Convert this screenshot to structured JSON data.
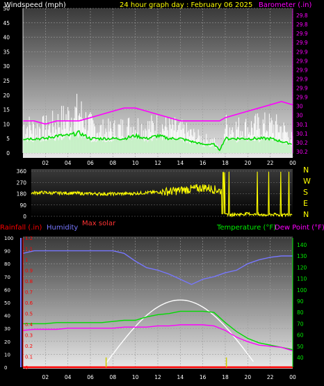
{
  "header": {
    "windspeed_label": "Windspeed (mph)",
    "title": "24 hour graph day : February 06 2025",
    "barometer_label": "Barometer (.in)"
  },
  "labels": {
    "max_solar": "Max solar",
    "rainfall": "Rainfall (.in)",
    "humidity": "Humidity",
    "temperature": "Temperature (°F)",
    "dewpoint": "Dew Point (°F)"
  },
  "x_ticks": [
    "02",
    "04",
    "06",
    "08",
    "10",
    "12",
    "14",
    "16",
    "18",
    "20",
    "22",
    "00"
  ],
  "colors": {
    "wind_gust": "#ffffff",
    "wind_avg_fill": "#bff0bf",
    "wind_avg": "#00dd00",
    "barometer": "#ff00ff",
    "direction": "#ffff00",
    "humidity": "#7777ff",
    "temperature": "#00dd00",
    "dewpoint": "#ff00ff",
    "solar": "#ffffff",
    "rain": "#ff0000",
    "title": "#ffff00",
    "wind_label": "#ffffff",
    "baro_label": "#ff00ff",
    "rain_label": "#ff0000",
    "humidity_label": "#7777ff",
    "temp_label": "#00ee00",
    "solar_label": "#ff3333"
  },
  "chart_data": [
    {
      "type": "line",
      "name": "wind_and_barometer",
      "x_hours": [
        0,
        1,
        2,
        3,
        4,
        5,
        6,
        7,
        8,
        9,
        10,
        11,
        12,
        13,
        14,
        15,
        16,
        17,
        17.5,
        18,
        19,
        20,
        21,
        22,
        23,
        24
      ],
      "series": [
        {
          "name": "Windspeed",
          "unit": "mph",
          "values": [
            12,
            11,
            11,
            13,
            16,
            18,
            12,
            10,
            10,
            11,
            12,
            11,
            12,
            11,
            10,
            8,
            6,
            5,
            1,
            12,
            11,
            11,
            12,
            12,
            11,
            6
          ]
        },
        {
          "name": "Wind average",
          "unit": "mph",
          "values": [
            5,
            5,
            5,
            6,
            6,
            7,
            5,
            5,
            5,
            5,
            6,
            5,
            6,
            5,
            5,
            4,
            3,
            3,
            1,
            5,
            5,
            5,
            5,
            5,
            4,
            3
          ]
        },
        {
          "name": "Barometer",
          "unit": "in",
          "values": [
            29.9,
            29.9,
            29.89,
            29.9,
            29.9,
            29.9,
            29.91,
            29.92,
            29.93,
            29.94,
            29.94,
            29.93,
            29.92,
            29.91,
            29.9,
            29.9,
            29.9,
            29.9,
            29.9,
            29.91,
            29.92,
            29.93,
            29.94,
            29.95,
            29.96,
            29.95
          ]
        }
      ],
      "y_left": {
        "label": "Windspeed (mph)",
        "range": [
          0,
          50
        ],
        "ticks": [
          0,
          5,
          10,
          15,
          20,
          25,
          30,
          35,
          40,
          45,
          50
        ]
      },
      "y_right": {
        "label": "Barometer (.in)",
        "range": [
          29.8,
          30.25
        ],
        "ticks": [
          "29.8",
          "29.8",
          "29.9",
          "29.9",
          "29.9",
          "29.9",
          "29.9",
          "29.9",
          "29.9",
          "29.9",
          "30",
          "30",
          "30.1",
          "30.1",
          "30.2",
          "30.2"
        ]
      },
      "grid": true
    },
    {
      "type": "line",
      "name": "wind_direction",
      "x_hours": [
        0,
        1,
        2,
        3,
        4,
        5,
        6,
        7,
        8,
        9,
        10,
        11,
        12,
        13,
        14,
        15,
        16,
        17,
        17.5,
        18,
        19,
        20,
        21,
        22,
        23,
        24
      ],
      "series": [
        {
          "name": "Direction",
          "unit": "deg",
          "values": [
            185,
            190,
            185,
            185,
            185,
            180,
            180,
            178,
            180,
            180,
            185,
            190,
            195,
            200,
            210,
            220,
            230,
            210,
            200,
            10,
            15,
            20,
            10,
            15,
            10,
            15
          ]
        }
      ],
      "y_left": {
        "range": [
          0,
          360
        ],
        "ticks": [
          0,
          90,
          180,
          270,
          360
        ]
      },
      "compass": [
        "N",
        "W",
        "S",
        "E",
        "N"
      ]
    },
    {
      "type": "line",
      "name": "rain_humidity_temperature",
      "x_hours": [
        0,
        1,
        2,
        3,
        4,
        5,
        6,
        7,
        8,
        9,
        10,
        11,
        12,
        13,
        14,
        15,
        16,
        17,
        18,
        19,
        20,
        21,
        22,
        23,
        24
      ],
      "series": [
        {
          "name": "Humidity",
          "unit": "%",
          "axis": "humidity",
          "values": [
            88,
            90,
            90,
            90,
            90,
            90,
            90,
            90,
            90,
            88,
            82,
            77,
            75,
            72,
            68,
            64,
            68,
            70,
            73,
            75,
            80,
            83,
            85,
            86,
            86
          ]
        },
        {
          "name": "Temperature",
          "unit": "°F",
          "axis": "temperature",
          "values": [
            70,
            70,
            70,
            71,
            71,
            71,
            71,
            71,
            72,
            73,
            73,
            76,
            78,
            79,
            81,
            81,
            81,
            80,
            71,
            63,
            57,
            53,
            51,
            49,
            47
          ]
        },
        {
          "name": "Dew Point",
          "unit": "°F",
          "axis": "temperature",
          "values": [
            64,
            65,
            65,
            65,
            66,
            66,
            66,
            66,
            66,
            67,
            67,
            67,
            68,
            68,
            69,
            69,
            69,
            68,
            64,
            58,
            54,
            51,
            50,
            49,
            46
          ]
        },
        {
          "name": "Max solar",
          "axis": "temperature",
          "values": [
            null,
            null,
            null,
            null,
            null,
            null,
            null,
            null,
            null,
            null,
            40,
            56,
            75,
            87,
            91,
            87,
            75,
            56,
            40,
            null,
            null,
            null,
            null,
            null,
            null
          ]
        },
        {
          "name": "Rainfall",
          "unit": "in",
          "axis": "rain",
          "values": [
            0,
            0,
            0,
            0,
            0,
            0,
            0,
            0,
            0,
            0,
            0,
            0,
            0,
            0,
            0,
            0,
            0,
            0,
            0,
            0,
            0,
            0,
            0,
            0,
            0
          ]
        }
      ],
      "y_humidity": {
        "label": "Humidity",
        "range": [
          0,
          100
        ],
        "ticks": [
          0,
          10,
          20,
          30,
          40,
          50,
          60,
          70,
          80,
          90,
          100
        ]
      },
      "y_rain": {
        "label": "Rainfall (.in)",
        "range": [
          0,
          1.2
        ],
        "ticks": [
          "0",
          "0.1",
          "0.2",
          "0.3",
          "0.4",
          "0.5",
          "0.6",
          "0.7",
          "0.8",
          "0.9",
          "1",
          "1.1",
          "1.2"
        ]
      },
      "y_temperature": {
        "label": "Temperature (°F)",
        "range": [
          35,
          145
        ],
        "ticks": [
          40,
          50,
          60,
          70,
          80,
          90,
          100,
          110,
          120,
          130,
          140
        ]
      },
      "solar_ticks_hours": [
        7.4,
        18.1
      ],
      "grid": true
    }
  ]
}
